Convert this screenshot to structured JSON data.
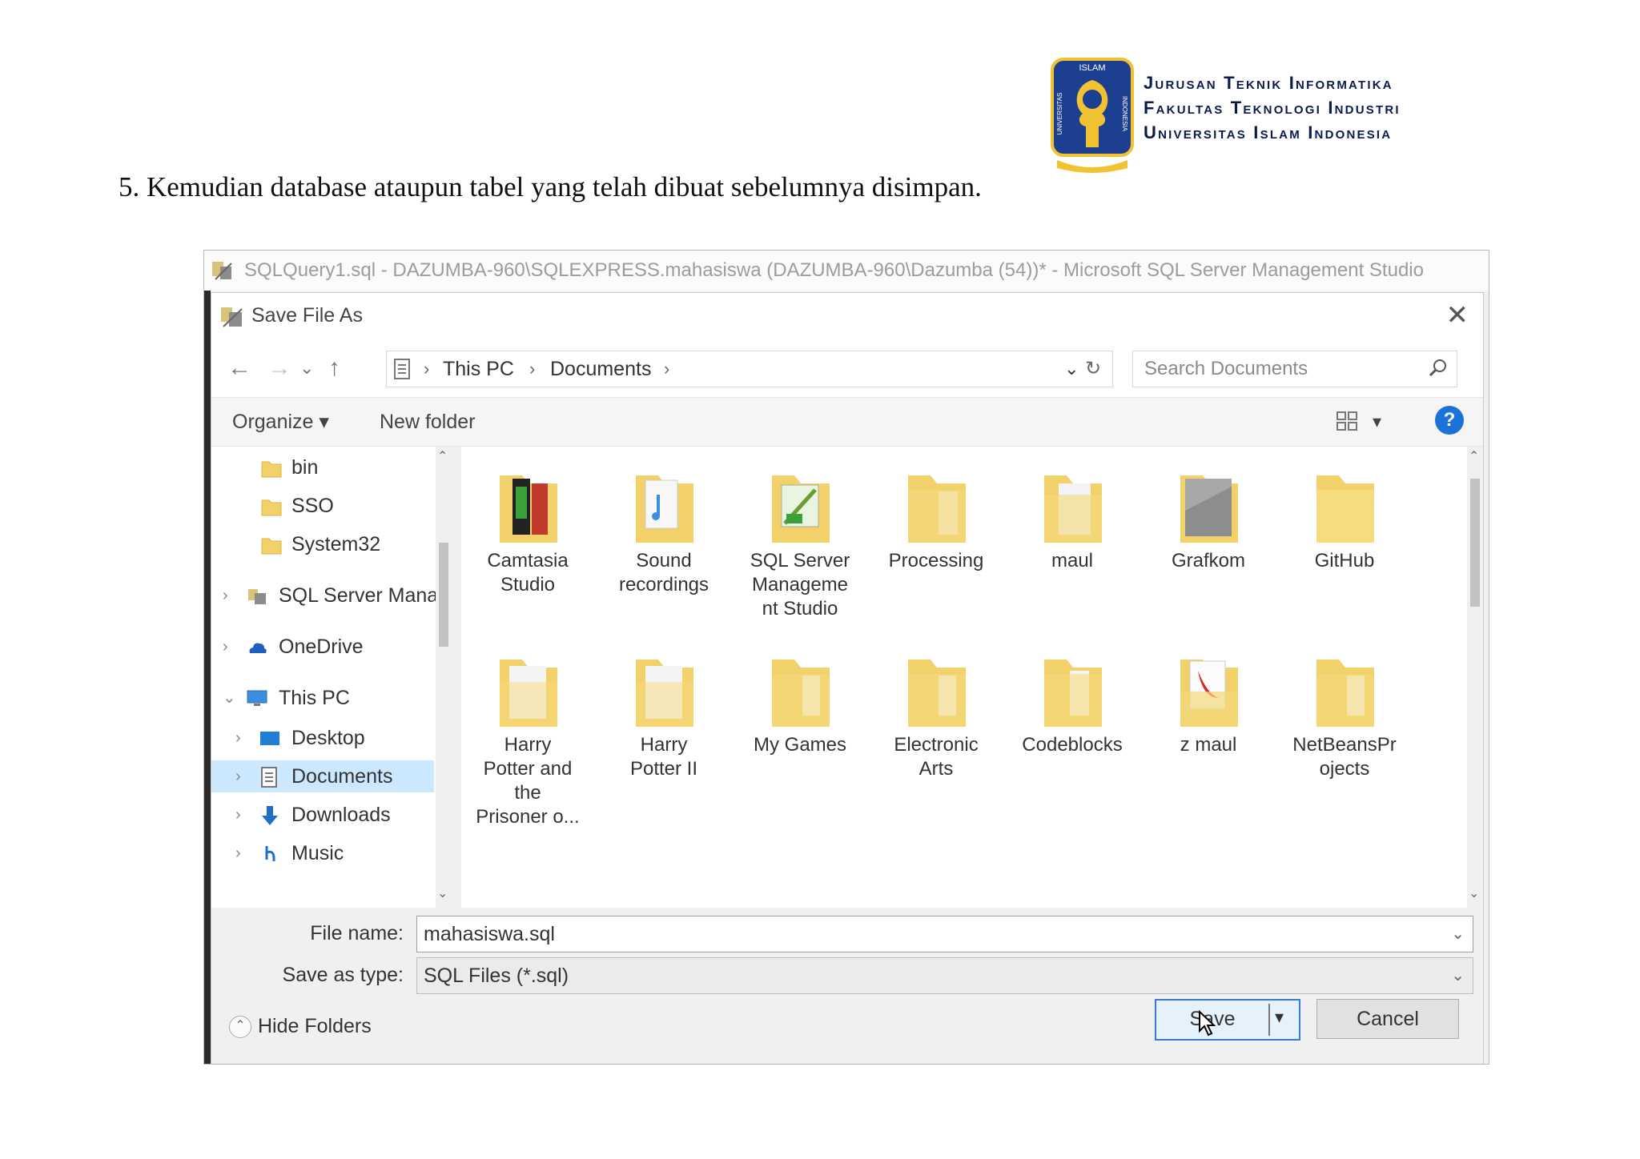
{
  "header": {
    "institution_lines": [
      "Jurusan Teknik Informatika",
      "Fakultas Teknologi Industri",
      "Universitas Islam Indonesia"
    ],
    "logo_text_top": "ISLAM",
    "logo_text_left": "UNIVERSITAS",
    "logo_text_right": "INDONESIA"
  },
  "instruction": "5. Kemudian database ataupun tabel yang telah dibuat sebelumnya disimpan.",
  "ssms_window_title": "SQLQuery1.sql - DAZUMBA-960\\SQLEXPRESS.mahasiswa (DAZUMBA-960\\Dazumba (54))* - Microsoft SQL Server Management Studio",
  "dialog": {
    "title": "Save File As",
    "close_label": "✕",
    "nav": {
      "back": "←",
      "forward": "→",
      "recent": "⌄",
      "up": "↑",
      "breadcrumb": [
        "This PC",
        "Documents"
      ],
      "refresh": "↻",
      "address_dropdown": "⌄",
      "search_placeholder": "Search Documents"
    },
    "commands": {
      "organize": "Organize ▾",
      "new_folder": "New folder",
      "view_arrow": "▾",
      "help": "?"
    },
    "nav_pane": [
      {
        "label": "bin",
        "icon": "folder-icon",
        "level": 2,
        "chev": ""
      },
      {
        "label": "SSO",
        "icon": "folder-icon",
        "level": 2,
        "chev": ""
      },
      {
        "label": "System32",
        "icon": "folder-icon",
        "level": 2,
        "chev": ""
      },
      {
        "label": "SQL Server Manag",
        "icon": "ssms-icon",
        "level": 1,
        "chev": "›"
      },
      {
        "label": "OneDrive",
        "icon": "cloud-icon",
        "level": 1,
        "chev": "›"
      },
      {
        "label": "This PC",
        "icon": "monitor-icon",
        "level": 1,
        "chev": "⌄"
      },
      {
        "label": "Desktop",
        "icon": "desktop-icon",
        "level": 2,
        "chev": "›"
      },
      {
        "label": "Documents",
        "icon": "documents-icon",
        "level": 2,
        "chev": "›",
        "selected": true
      },
      {
        "label": "Downloads",
        "icon": "download-arrow-icon",
        "level": 2,
        "chev": "›"
      },
      {
        "label": "Music",
        "icon": "music-note-icon",
        "level": 2,
        "chev": "›"
      }
    ],
    "files": [
      {
        "name": "Camtasia\nStudio",
        "icon": "camtasia-folder-icon"
      },
      {
        "name": "Sound\nrecordings",
        "icon": "music-folder-icon"
      },
      {
        "name": "SQL Server\nManageme\nnt Studio",
        "icon": "sql-folder-icon"
      },
      {
        "name": "Processing",
        "icon": "folder-icon"
      },
      {
        "name": "maul",
        "icon": "folder-icon"
      },
      {
        "name": "Grafkom",
        "icon": "grafkom-folder-icon"
      },
      {
        "name": "GitHub",
        "icon": "folder-icon"
      },
      {
        "name": "Harry\nPotter and\nthe\nPrisoner o...",
        "icon": "folder-icon"
      },
      {
        "name": "Harry\nPotter II",
        "icon": "folder-icon"
      },
      {
        "name": "My Games",
        "icon": "folder-icon"
      },
      {
        "name": "Electronic\nArts",
        "icon": "folder-icon"
      },
      {
        "name": "Codeblocks",
        "icon": "folder-icon"
      },
      {
        "name": "z maul",
        "icon": "pdf-folder-icon"
      },
      {
        "name": "NetBeansPr\nojects",
        "icon": "folder-icon"
      }
    ],
    "form": {
      "file_name_label": "File name:",
      "file_name_value": "mahasiswa.sql",
      "save_type_label": "Save as type:",
      "save_type_value": "SQL Files (*.sql)",
      "dropdown": "⌄"
    },
    "footer": {
      "hide_folders": "Hide Folders",
      "save": "Save",
      "save_arrow": "▾",
      "cancel": "Cancel"
    }
  },
  "colors": {
    "accent": "#1a73d9",
    "selection": "#cce8ff",
    "folder": "#f2d16b",
    "institution_text": "#0b1a4d",
    "logo_blue": "#1d3f8f",
    "logo_gold": "#f1c232"
  }
}
